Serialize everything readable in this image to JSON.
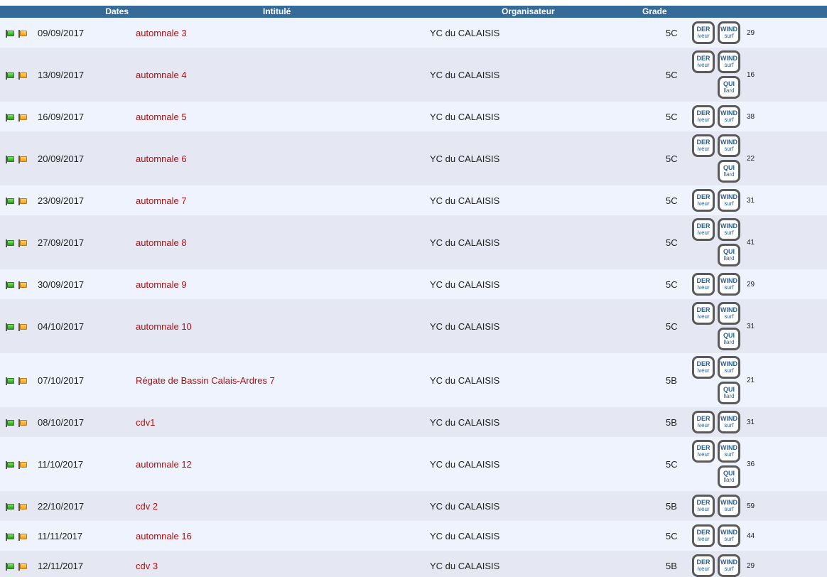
{
  "header": {
    "dates": "Dates",
    "intitule": "Intitulé",
    "organisateur": "Organisateur",
    "grade": "Grade"
  },
  "badges": {
    "der": {
      "top": "DER",
      "bottom": "iveur"
    },
    "wind": {
      "top": "WIND",
      "bottom": "surf"
    },
    "qui": {
      "top": "QUI",
      "bottom": "llard"
    }
  },
  "icons": {
    "first": "green-flag-icon",
    "second": "orange-flag-icon"
  },
  "colors": {
    "header_bg": "#356a99",
    "title_link": "#b01010",
    "badge_text": "#2b5e95"
  },
  "rows": [
    {
      "date": "09/09/2017",
      "title": "automnale 3",
      "organizer": "YC du CALAISIS",
      "grade": "5C",
      "quillard": false,
      "count": "29"
    },
    {
      "date": "13/09/2017",
      "title": "automnale 4",
      "organizer": "YC du CALAISIS",
      "grade": "5C",
      "quillard": true,
      "count": "16"
    },
    {
      "date": "16/09/2017",
      "title": "automnale 5",
      "organizer": "YC du CALAISIS",
      "grade": "5C",
      "quillard": false,
      "count": "38"
    },
    {
      "date": "20/09/2017",
      "title": "automnale 6",
      "organizer": "YC du CALAISIS",
      "grade": "5C",
      "quillard": true,
      "count": "22"
    },
    {
      "date": "23/09/2017",
      "title": "automnale 7",
      "organizer": "YC du CALAISIS",
      "grade": "5C",
      "quillard": false,
      "count": "31"
    },
    {
      "date": "27/09/2017",
      "title": "automnale 8",
      "organizer": "YC du CALAISIS",
      "grade": "5C",
      "quillard": true,
      "count": "41"
    },
    {
      "date": "30/09/2017",
      "title": "automnale 9",
      "organizer": "YC du CALAISIS",
      "grade": "5C",
      "quillard": false,
      "count": "29"
    },
    {
      "date": "04/10/2017",
      "title": "automnale 10",
      "organizer": "YC du CALAISIS",
      "grade": "5C",
      "quillard": true,
      "count": "31"
    },
    {
      "date": "07/10/2017",
      "title": "Régate de Bassin Calais-Ardres 7",
      "organizer": "YC du CALAISIS",
      "grade": "5B",
      "quillard": true,
      "count": "21"
    },
    {
      "date": "08/10/2017",
      "title": "cdv1",
      "organizer": "YC du CALAISIS",
      "grade": "5B",
      "quillard": false,
      "count": "31"
    },
    {
      "date": "11/10/2017",
      "title": "automnale 12",
      "organizer": "YC du CALAISIS",
      "grade": "5C",
      "quillard": true,
      "count": "36"
    },
    {
      "date": "22/10/2017",
      "title": "cdv 2",
      "organizer": "YC du CALAISIS",
      "grade": "5B",
      "quillard": false,
      "count": "59"
    },
    {
      "date": "11/11/2017",
      "title": "automnale 16",
      "organizer": "YC du CALAISIS",
      "grade": "5C",
      "quillard": false,
      "count": "44"
    },
    {
      "date": "12/11/2017",
      "title": "cdv 3",
      "organizer": "YC du CALAISIS",
      "grade": "5B",
      "quillard": false,
      "count": "29"
    }
  ]
}
